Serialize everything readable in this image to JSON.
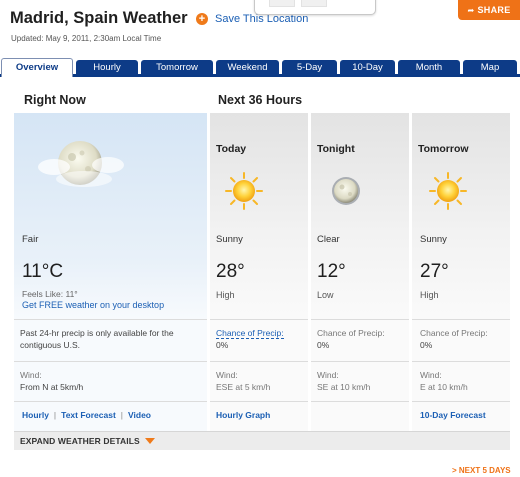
{
  "header": {
    "title": "Madrid, Spain Weather",
    "save_label": "Save This Location",
    "updated": "Updated: May 9, 2011, 2:30am Local Time",
    "share_label": "SHARE"
  },
  "tabs": [
    {
      "label": "Overview",
      "active": true
    },
    {
      "label": "Hourly"
    },
    {
      "label": "Tomorrow"
    },
    {
      "label": "Weekend"
    },
    {
      "label": "5-Day"
    },
    {
      "label": "10-Day"
    },
    {
      "label": "Month"
    },
    {
      "label": "Map"
    }
  ],
  "sections": {
    "right_now": "Right Now",
    "next_36": "Next 36 Hours"
  },
  "now": {
    "condition": "Fair",
    "temp": "11°C",
    "feels_like_label": "Feels Like:",
    "feels_like_value": "11°",
    "get_free": "Get FREE weather on your desktop",
    "precip_note": "Past 24-hr precip is only available for the contiguous U.S.",
    "wind_label": "Wind:",
    "wind_value": "From N at 5km/h",
    "links": [
      "Hourly",
      "Text Forecast",
      "Video"
    ]
  },
  "forecast": [
    {
      "period": "Today",
      "condition": "Sunny",
      "temp": "28°",
      "sub": "High",
      "precip_label": "Chance of Precip:",
      "precip": "0%",
      "wind_label": "Wind:",
      "wind": "ESE at 5 km/h",
      "link": "Hourly Graph",
      "icon": "sun-icon"
    },
    {
      "period": "Tonight",
      "condition": "Clear",
      "temp": "12°",
      "sub": "Low",
      "precip_label": "Chance of Precip:",
      "precip": "0%",
      "wind_label": "Wind:",
      "wind": "SE at 10 km/h",
      "link": "",
      "icon": "moon-icon"
    },
    {
      "period": "Tomorrow",
      "condition": "Sunny",
      "temp": "27°",
      "sub": "High",
      "precip_label": "Chance of Precip:",
      "precip": "0%",
      "wind_label": "Wind:",
      "wind": "E at 10 km/h",
      "link": "10-Day Forecast",
      "icon": "sun-icon"
    }
  ],
  "expand_label": "EXPAND WEATHER DETAILS",
  "next5_label": "> NEXT 5 DAYS",
  "colors": {
    "accent": "#ef7217",
    "tab": "#0d3b87",
    "link": "#1b5fb4"
  }
}
